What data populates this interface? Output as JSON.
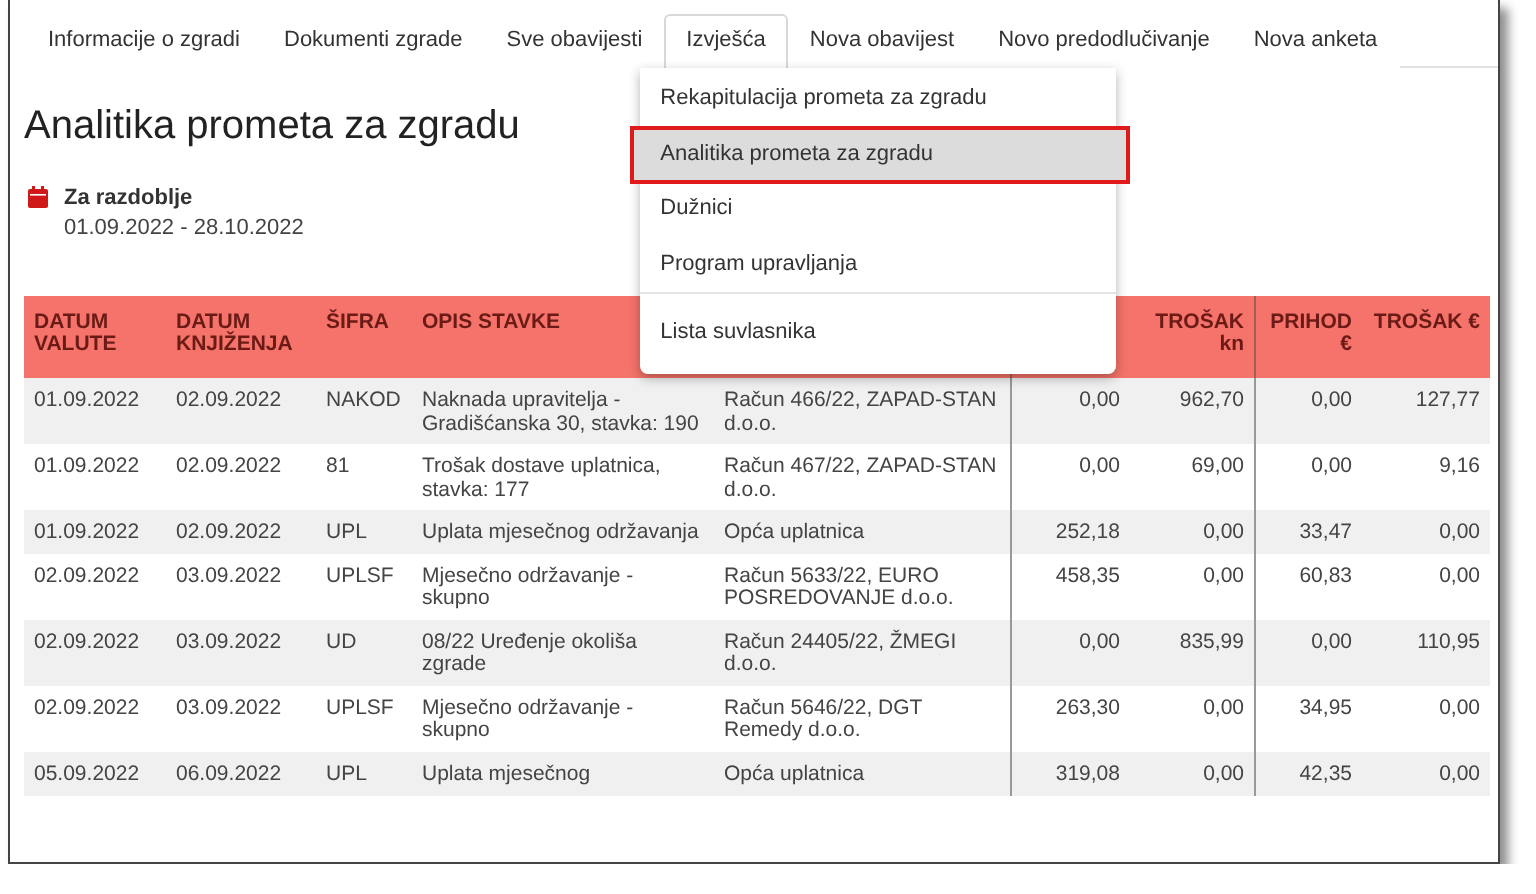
{
  "tabs": [
    {
      "label": "Informacije o zgradi",
      "selected": false
    },
    {
      "label": "Dokumenti zgrade",
      "selected": false
    },
    {
      "label": "Sve obavijesti",
      "selected": false
    },
    {
      "label": "Izvješća",
      "selected": true,
      "menu": {
        "groups": [
          [
            {
              "label": "Rekapitulacija prometa za zgradu",
              "selected": false
            },
            {
              "label": "Analitika prometa za zgradu",
              "selected": true
            },
            {
              "label": "Dužnici",
              "selected": false
            },
            {
              "label": "Program upravljanja",
              "selected": false
            }
          ],
          [
            {
              "label": "Lista suvlasnika",
              "selected": false
            }
          ]
        ]
      }
    },
    {
      "label": "Nova obavijest",
      "selected": false
    },
    {
      "label": "Novo predodlučivanje",
      "selected": false
    },
    {
      "label": "Nova anketa",
      "selected": false
    }
  ],
  "title": "Analitika prometa za zgradu",
  "period": {
    "label": "Za razdoblje",
    "value": "01.09.2022 - 28.10.2022"
  },
  "table": {
    "columns": [
      {
        "label": "DATUM VALUTE"
      },
      {
        "label": "DATUM KNJIŽENJA"
      },
      {
        "label": "ŠIFRA"
      },
      {
        "label": "OPIS STAVKE"
      },
      {},
      {},
      {
        "label": "TROŠAK kn"
      },
      {
        "label": "PRIHOD €"
      },
      {
        "label": "TROŠAK €"
      }
    ],
    "rows": [
      [
        "01.09.2022",
        "02.09.2022",
        "NAKOD",
        "Naknada upravitelja - Gradišćanska 30, stavka: 190",
        "Račun 466/22, ZAPAD-STAN d.o.o.",
        "0,00",
        "962,70",
        "0,00",
        "127,77"
      ],
      [
        "01.09.2022",
        "02.09.2022",
        "81",
        "Trošak dostave uplatnica, stavka: 177",
        "Račun 467/22, ZAPAD-STAN d.o.o.",
        "0,00",
        "69,00",
        "0,00",
        "9,16"
      ],
      [
        "01.09.2022",
        "02.09.2022",
        "UPL",
        "Uplata mjesečnog održavanja",
        "Opća uplatnica",
        "252,18",
        "0,00",
        "33,47",
        "0,00"
      ],
      [
        "02.09.2022",
        "03.09.2022",
        "UPLSF",
        "Mjesečno održavanje - skupno",
        "Račun 5633/22, EURO POSREDOVANJE d.o.o.",
        "458,35",
        "0,00",
        "60,83",
        "0,00"
      ],
      [
        "02.09.2022",
        "03.09.2022",
        "UD",
        "08/22 Uređenje okoliša zgrade",
        "Račun 24405/22, ŽMEGI d.o.o.",
        "0,00",
        "835,99",
        "0,00",
        "110,95"
      ],
      [
        "02.09.2022",
        "03.09.2022",
        "UPLSF",
        "Mjesečno održavanje - skupno",
        "Račun 5646/22, DGT Remedy d.o.o.",
        "263,30",
        "0,00",
        "34,95",
        "0,00"
      ],
      [
        "05.09.2022",
        "06.09.2022",
        "UPL",
        "Uplata mjesečnog",
        "Opća uplatnica",
        "319,08",
        "0,00",
        "42,35",
        "0,00"
      ]
    ]
  }
}
